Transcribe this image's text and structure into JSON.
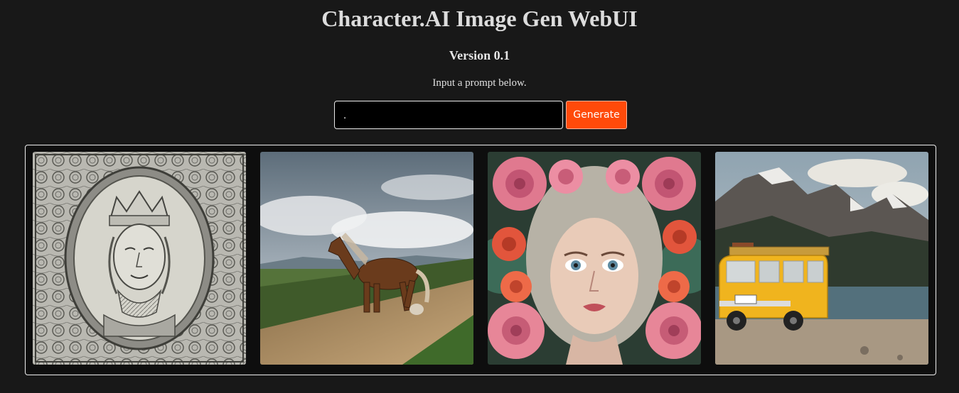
{
  "header": {
    "title": "Character.AI Image Gen WebUI",
    "version": "Version 0.1",
    "instruction": "Input a prompt below."
  },
  "prompt": {
    "value": ".",
    "placeholder": ""
  },
  "actions": {
    "generate_label": "Generate"
  },
  "colors": {
    "background": "#181818",
    "accent": "#ff4a0a"
  },
  "gallery": {
    "images": [
      {
        "subject": "ornate engraved portrait of a crowned face"
      },
      {
        "subject": "brown horse on a dirt hill under cloudy sky"
      },
      {
        "subject": "woman's face surrounded by pink and red flowers"
      },
      {
        "subject": "yellow van parked by a mountain lake"
      }
    ]
  }
}
